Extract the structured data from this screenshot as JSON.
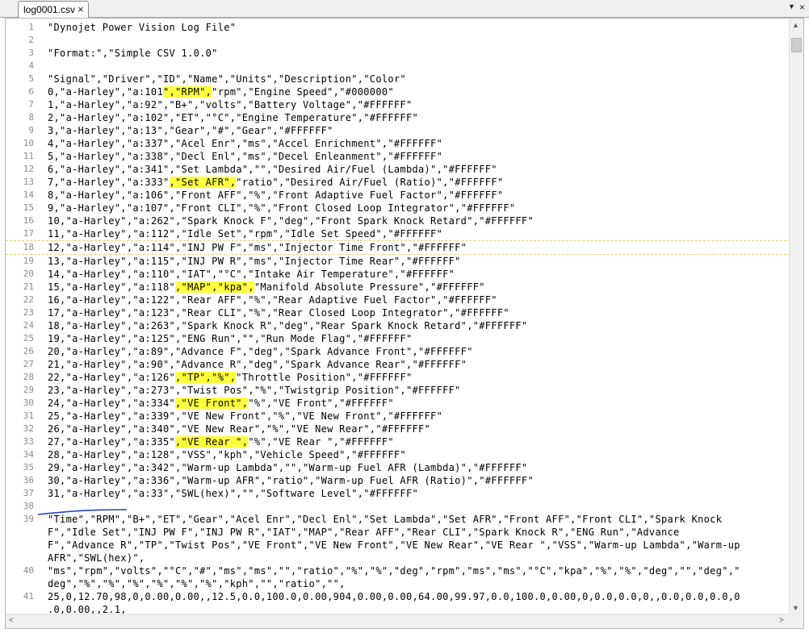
{
  "tab": {
    "title": "log0001.csv",
    "close_glyph": "×"
  },
  "window": {
    "dropdown_glyph": "▼",
    "close_glyph": "×"
  },
  "scroll": {
    "up": "▲",
    "down": "▼",
    "left": "<",
    "right": ">"
  },
  "colors": {
    "highlight": "#ffff3a",
    "line_number": "#8c8c8c",
    "pen_annotation": "#2a3fc0"
  },
  "lines": [
    {
      "n": "1",
      "segs": [
        {
          "t": "\"Dynojet Power Vision Log File\""
        }
      ]
    },
    {
      "n": "2",
      "segs": [
        {
          "t": ""
        }
      ]
    },
    {
      "n": "3",
      "segs": [
        {
          "t": "\"Format:\",\"Simple CSV 1.0.0\""
        }
      ]
    },
    {
      "n": "4",
      "segs": [
        {
          "t": ""
        }
      ]
    },
    {
      "n": "5",
      "segs": [
        {
          "t": "\"Signal\",\"Driver\",\"ID\",\"Name\",\"Units\",\"Description\",\"Color\""
        }
      ]
    },
    {
      "n": "6",
      "segs": [
        {
          "t": "0,\"a-Harley\",\"a:101"
        },
        {
          "t": "\",\"RPM\",",
          "h": true
        },
        {
          "t": "\"rpm\",\"Engine Speed\",\"#000000\""
        }
      ]
    },
    {
      "n": "7",
      "segs": [
        {
          "t": "1,\"a-Harley\",\"a:92\",\"B+\",\"volts\",\"Battery Voltage\",\"#FFFFFF\""
        }
      ]
    },
    {
      "n": "8",
      "segs": [
        {
          "t": "2,\"a-Harley\",\"a:102\",\"ET\",\"°C\",\"Engine Temperature\",\"#FFFFFF\""
        }
      ]
    },
    {
      "n": "9",
      "segs": [
        {
          "t": "3,\"a-Harley\",\"a:13\",\"Gear\",\"#\",\"Gear\",\"#FFFFFF\""
        }
      ]
    },
    {
      "n": "10",
      "segs": [
        {
          "t": "4,\"a-Harley\",\"a:337\",\"Acel Enr\",\"ms\",\"Accel Enrichment\",\"#FFFFFF\""
        }
      ]
    },
    {
      "n": "11",
      "segs": [
        {
          "t": "5,\"a-Harley\",\"a:338\",\"Decl Enl\",\"ms\",\"Decel Enleanment\",\"#FFFFFF\""
        }
      ]
    },
    {
      "n": "12",
      "segs": [
        {
          "t": "6,\"a-Harley\",\"a:341\",\"Set Lambda\",\"\",\"Desired Air/Fuel (Lambda)\",\"#FFFFFF\""
        }
      ]
    },
    {
      "n": "13",
      "segs": [
        {
          "t": "7,\"a-Harley\",\"a:333\""
        },
        {
          "t": ",\"Set AFR\",",
          "h": true
        },
        {
          "t": "\"ratio\",\"Desired Air/Fuel (Ratio)\",\"#FFFFFF\""
        }
      ]
    },
    {
      "n": "14",
      "segs": [
        {
          "t": "8,\"a-Harley\",\"a:106\",\"Front AFF\",\"%\",\"Front Adaptive Fuel Factor\",\"#FFFFFF\""
        }
      ]
    },
    {
      "n": "15",
      "segs": [
        {
          "t": "9,\"a-Harley\",\"a:107\",\"Front CLI\",\"%\",\"Front Closed Loop Integrator\",\"#FFFFFF\""
        }
      ]
    },
    {
      "n": "16",
      "segs": [
        {
          "t": "10,\"a-Harley\",\"a:262\",\"Spark Knock F\",\"deg\",\"Front Spark Knock Retard\",\"#FFFFFF\""
        }
      ]
    },
    {
      "n": "17",
      "segs": [
        {
          "t": "11,\"a-Harley\",\"a:112\",\"Idle Set\",\"rpm\",\"Idle Set Speed\",\"#FFFFFF\""
        }
      ]
    },
    {
      "n": "18",
      "cur": true,
      "segs": [
        {
          "t": "12,\"a-Harley\",\"a:114\",\"INJ PW F\",\"ms\",\"Injector Time Front\",\"#FFFFFF\""
        }
      ]
    },
    {
      "n": "19",
      "segs": [
        {
          "t": "13,\"a-Harley\",\"a:115\",\"INJ PW R\",\"ms\",\"Injector Time Rear\",\"#FFFFFF\""
        }
      ]
    },
    {
      "n": "20",
      "segs": [
        {
          "t": "14,\"a-Harley\",\"a:110\",\"IAT\",\"°C\",\"Intake Air Temperature\",\"#FFFFFF\""
        }
      ]
    },
    {
      "n": "21",
      "segs": [
        {
          "t": "15,\"a-Harley\",\"a:118\""
        },
        {
          "t": ",\"MAP\",\"kpa\",",
          "h": true
        },
        {
          "t": "\"Manifold Absolute Pressure\",\"#FFFFFF\""
        }
      ]
    },
    {
      "n": "22",
      "segs": [
        {
          "t": "16,\"a-Harley\",\"a:122\",\"Rear AFF\",\"%\",\"Rear Adaptive Fuel Factor\",\"#FFFFFF\""
        }
      ]
    },
    {
      "n": "23",
      "segs": [
        {
          "t": "17,\"a-Harley\",\"a:123\",\"Rear CLI\",\"%\",\"Rear Closed Loop Integrator\",\"#FFFFFF\""
        }
      ]
    },
    {
      "n": "24",
      "segs": [
        {
          "t": "18,\"a-Harley\",\"a:263\",\"Spark Knock R\",\"deg\",\"Rear Spark Knock Retard\",\"#FFFFFF\""
        }
      ]
    },
    {
      "n": "25",
      "segs": [
        {
          "t": "19,\"a-Harley\",\"a:125\",\"ENG Run\",\"\",\"Run Mode Flag\",\"#FFFFFF\""
        }
      ]
    },
    {
      "n": "26",
      "segs": [
        {
          "t": "20,\"a-Harley\",\"a:89\",\"Advance F\",\"deg\",\"Spark Advance Front\",\"#FFFFFF\""
        }
      ]
    },
    {
      "n": "27",
      "segs": [
        {
          "t": "21,\"a-Harley\",\"a:90\",\"Advance R\",\"deg\",\"Spark Advance Rear\",\"#FFFFFF\""
        }
      ]
    },
    {
      "n": "28",
      "segs": [
        {
          "t": "22,\"a-Harley\",\"a:126\""
        },
        {
          "t": ",\"TP\",\"%\",",
          "h": true
        },
        {
          "t": "\"Throttle Position\",\"#FFFFFF\""
        }
      ]
    },
    {
      "n": "29",
      "segs": [
        {
          "t": "23,\"a-Harley\",\"a:273\",\"Twist Pos\",\"%\",\"Twistgrip Position\",\"#FFFFFF\""
        }
      ]
    },
    {
      "n": "30",
      "segs": [
        {
          "t": "24,\"a-Harley\",\"a:334\""
        },
        {
          "t": ",\"VE Front\",",
          "h": true
        },
        {
          "t": "\"%\",\"VE Front\",\"#FFFFFF\""
        }
      ]
    },
    {
      "n": "31",
      "segs": [
        {
          "t": "25,\"a-Harley\",\"a:339\",\"VE New Front\",\"%\",\"VE New Front\",\"#FFFFFF\""
        }
      ]
    },
    {
      "n": "32",
      "segs": [
        {
          "t": "26,\"a-Harley\",\"a:340\",\"VE New Rear\",\"%\",\"VE New Rear\",\"#FFFFFF\""
        }
      ]
    },
    {
      "n": "33",
      "segs": [
        {
          "t": "27,\"a-Harley\",\"a:335\""
        },
        {
          "t": ",\"VE Rear \",",
          "h": true
        },
        {
          "t": "\"%\",\"VE Rear \",\"#FFFFFF\""
        }
      ]
    },
    {
      "n": "34",
      "segs": [
        {
          "t": "28,\"a-Harley\",\"a:128\",\"VSS\",\"kph\",\"Vehicle Speed\",\"#FFFFFF\""
        }
      ]
    },
    {
      "n": "35",
      "segs": [
        {
          "t": "29,\"a-Harley\",\"a:342\",\"Warm-up Lambda\",\"\",\"Warm-up Fuel AFR (Lambda)\",\"#FFFFFF\""
        }
      ]
    },
    {
      "n": "36",
      "segs": [
        {
          "t": "30,\"a-Harley\",\"a:336\",\"Warm-up AFR\",\"ratio\",\"Warm-up Fuel AFR (Ratio)\",\"#FFFFFF\""
        }
      ]
    },
    {
      "n": "37",
      "segs": [
        {
          "t": "31,\"a-Harley\",\"a:33\",\"SWL(hex)\",\"\",\"Software Level\",\"#FFFFFF\""
        }
      ]
    },
    {
      "n": "38",
      "segs": [
        {
          "t": ""
        }
      ]
    },
    {
      "n": "39",
      "segs": [
        {
          "t": "\"Time\",\"RPM\",\"B+\",\"ET\",\"Gear\",\"Acel Enr\",\"Decl Enl\",\"Set Lambda\",\"Set AFR\",\"Front AFF\",\"Front CLI\",\"Spark Knock"
        }
      ]
    },
    {
      "n": "",
      "segs": [
        {
          "t": "F\",\"Idle Set\",\"INJ PW F\",\"INJ PW R\",\"IAT\",\"MAP\",\"Rear AFF\",\"Rear CLI\",\"Spark Knock R\",\"ENG Run\",\"Advance"
        }
      ]
    },
    {
      "n": "",
      "segs": [
        {
          "t": "F\",\"Advance R\",\"TP\",\"Twist Pos\",\"VE Front\",\"VE New Front\",\"VE New Rear\",\"VE Rear \",\"VSS\",\"Warm-up Lambda\",\"Warm-up"
        }
      ]
    },
    {
      "n": "",
      "segs": [
        {
          "t": "AFR\",\"SWL(hex)\","
        }
      ]
    },
    {
      "n": "40",
      "segs": [
        {
          "t": "\"ms\",\"rpm\",\"volts\",\"°C\",\"#\",\"ms\",\"ms\",\"\",\"ratio\",\"%\",\"%\",\"deg\",\"rpm\",\"ms\",\"ms\",\"°C\",\"kpa\",\"%\",\"%\",\"deg\",\"\",\"deg\",\""
        }
      ]
    },
    {
      "n": "",
      "segs": [
        {
          "t": "deg\",\"%\",\"%\",\"%\",\"%\",\"%\",\"%\",\"kph\",\"\",\"ratio\",\"\","
        }
      ]
    },
    {
      "n": "41",
      "segs": [
        {
          "t": "25,0,12.70,98,0,0.00,0.00,,12.5,0.0,100.0,0.00,904,0.00,0.00,64.00,99.97,0.0,100.0,0.00,0,0.0,0.0,0,,0.0,0.0,0.0,0"
        }
      ]
    },
    {
      "n": "",
      "segs": [
        {
          "t": ".0,0.00,,2.1,"
        }
      ]
    }
  ]
}
